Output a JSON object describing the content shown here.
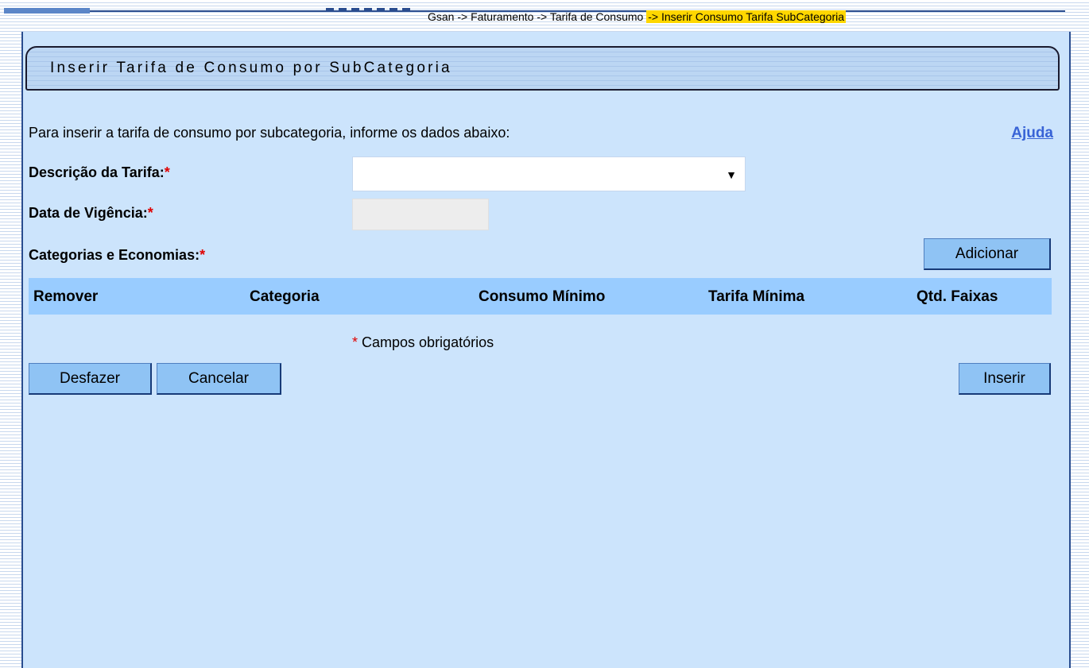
{
  "breadcrumb": {
    "trail": "Gsan -> Faturamento -> Tarifa de Consumo ",
    "current": "-> Inserir Consumo Tarifa SubCategoria"
  },
  "page": {
    "title": "Inserir Tarifa de Consumo por SubCategoria",
    "intro": "Para inserir a tarifa de consumo por subcategoria, informe os dados abaixo:",
    "help_link": "Ajuda"
  },
  "form": {
    "descricao_label": "Descrição da Tarifa:",
    "descricao_value": "",
    "data_vigencia_label": "Data de Vigência:",
    "data_vigencia_value": "",
    "categorias_label": "Categorias e Economias:",
    "required_marker": "*"
  },
  "buttons": {
    "adicionar": "Adicionar",
    "desfazer": "Desfazer",
    "cancelar": "Cancelar",
    "inserir": "Inserir"
  },
  "table": {
    "columns": [
      "Remover",
      "Categoria",
      "Consumo Mínimo",
      "Tarifa Mínima",
      "Qtd. Faixas"
    ],
    "rows": []
  },
  "footnote": {
    "marker": "*",
    "text": " Campos obrigatórios"
  },
  "colors": {
    "panel_bg": "#cce4fc",
    "button_bg": "#8fc3f4",
    "table_header_bg": "#99ccff",
    "required": "#e00000",
    "link": "#3863d6",
    "breadcrumb_highlight": "#ffd700"
  }
}
